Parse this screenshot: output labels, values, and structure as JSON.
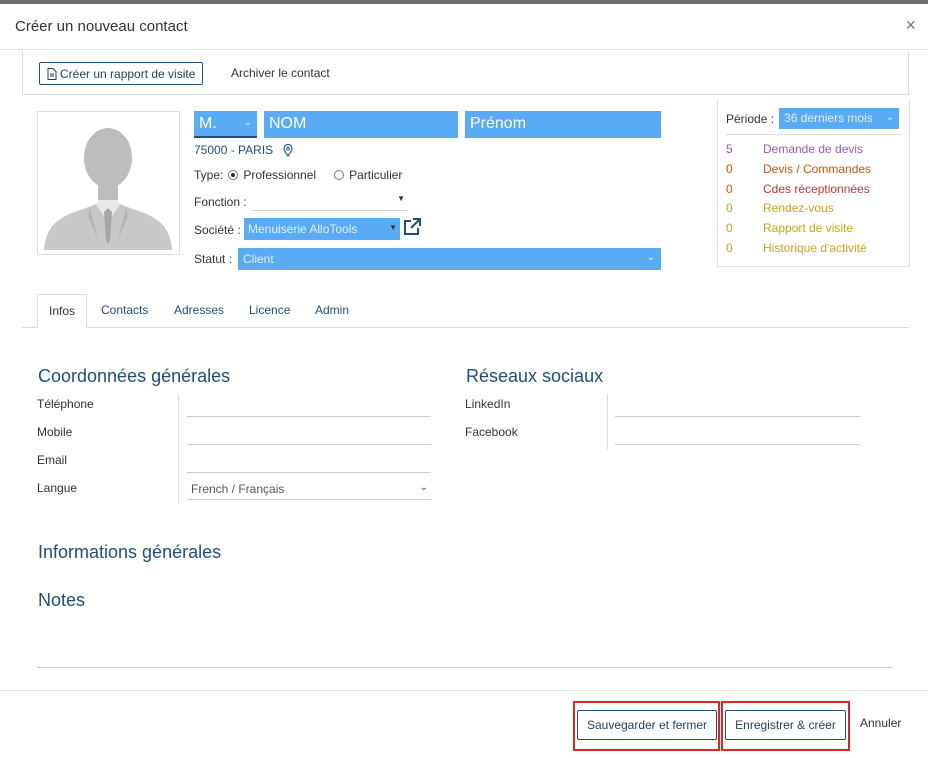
{
  "dialog": {
    "title": "Créer un nouveau contact",
    "close": "×"
  },
  "toolbar": {
    "report_button": "Créer un rapport de visite",
    "archive_link": "Archiver le contact"
  },
  "identity": {
    "civility": "M.",
    "nom_placeholder": "NOM",
    "prenom_placeholder": "Prénom",
    "address": "75000 - PARIS",
    "type_label": "Type:",
    "type_options": [
      "Professionnel",
      "Particulier"
    ],
    "type_selected": "Professionnel",
    "fonction_label": "Fonction :",
    "fonction_value": "",
    "societe_label": "Société :",
    "societe_value": "Menuiserie AlloTools",
    "statut_label": "Statut :",
    "statut_value": "Client"
  },
  "period": {
    "label": "Période :",
    "value": "36 derniers mois",
    "stats": [
      {
        "count": "5",
        "label": "Demande de devis",
        "color": "#9b59b6"
      },
      {
        "count": "0",
        "label": "Devis / Commandes",
        "color": "#d35400"
      },
      {
        "count": "0",
        "label": "Cdes réceptionnées",
        "color": "#c0392b"
      },
      {
        "count": "0",
        "label": "Rendez-vous",
        "color": "#d4a017"
      },
      {
        "count": "0",
        "label": "Rapport de visite",
        "color": "#d4a017"
      },
      {
        "count": "0",
        "label": "Historique d'activité",
        "color": "#d4a017"
      }
    ]
  },
  "tabs": [
    "Infos",
    "Contacts",
    "Adresses",
    "Licence",
    "Admin"
  ],
  "general": {
    "title": "Coordonnées générales",
    "fields": [
      "Téléphone",
      "Mobile",
      "Email",
      "Langue"
    ],
    "langue_value": "French / Français"
  },
  "social": {
    "title": "Réseaux sociaux",
    "fields": [
      "LinkedIn",
      "Facebook"
    ]
  },
  "info_title": "Informations générales",
  "notes_title": "Notes",
  "footer": {
    "save_close": "Sauvegarder et fermer",
    "save_create": "Enregistrer & créer",
    "cancel": "Annuler"
  }
}
